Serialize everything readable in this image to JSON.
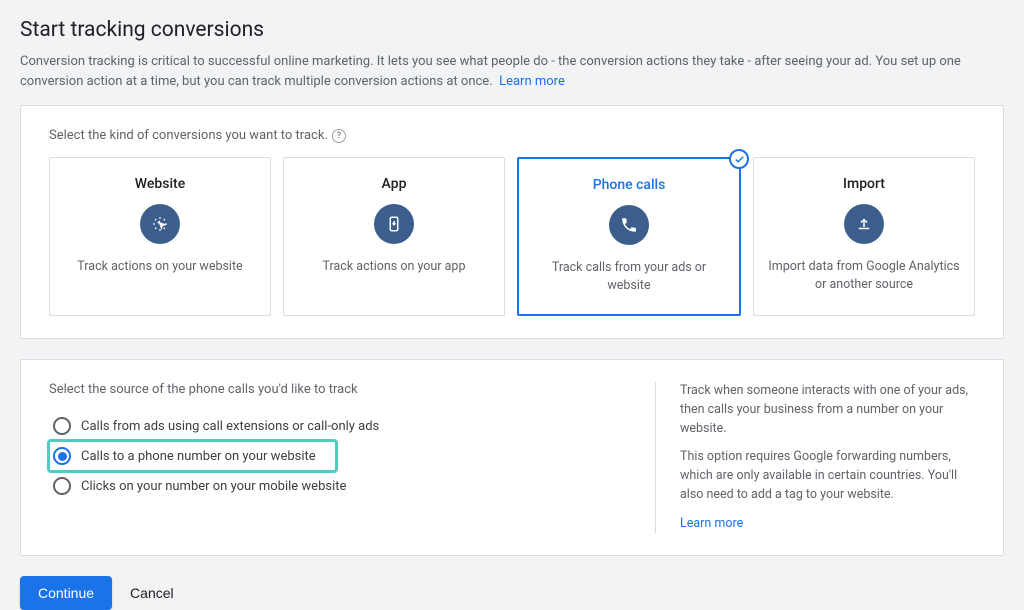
{
  "header": {
    "title": "Start tracking conversions",
    "description": "Conversion tracking is critical to successful online marketing. It lets you see what people do - the conversion actions they take - after seeing your ad. You set up one conversion action at a time, but you can track multiple conversion actions at once.",
    "learn_more": "Learn more"
  },
  "kind_section": {
    "label": "Select the kind of conversions you want to track.",
    "options": [
      {
        "title": "Website",
        "desc": "Track actions on your website",
        "icon": "cursor-click"
      },
      {
        "title": "App",
        "desc": "Track actions on your app",
        "icon": "phone-app"
      },
      {
        "title": "Phone calls",
        "desc": "Track calls from your ads or website",
        "icon": "phone",
        "selected": true
      },
      {
        "title": "Import",
        "desc": "Import data from Google Analytics or another source",
        "icon": "upload"
      }
    ]
  },
  "source_section": {
    "label": "Select the source of the phone calls you'd like to track",
    "radios": [
      {
        "label": "Calls from ads using call extensions or call-only ads",
        "checked": false
      },
      {
        "label": "Calls to a phone number on your website",
        "checked": true,
        "highlighted": true
      },
      {
        "label": "Clicks on your number on your mobile website",
        "checked": false
      }
    ],
    "help": {
      "p1": "Track when someone interacts with one of your ads, then calls your business from a number on your website.",
      "p2": "This option requires Google forwarding numbers, which are only available in certain countries. You'll also need to add a tag to your website.",
      "learn_more": "Learn more"
    }
  },
  "footer": {
    "continue": "Continue",
    "cancel": "Cancel"
  }
}
